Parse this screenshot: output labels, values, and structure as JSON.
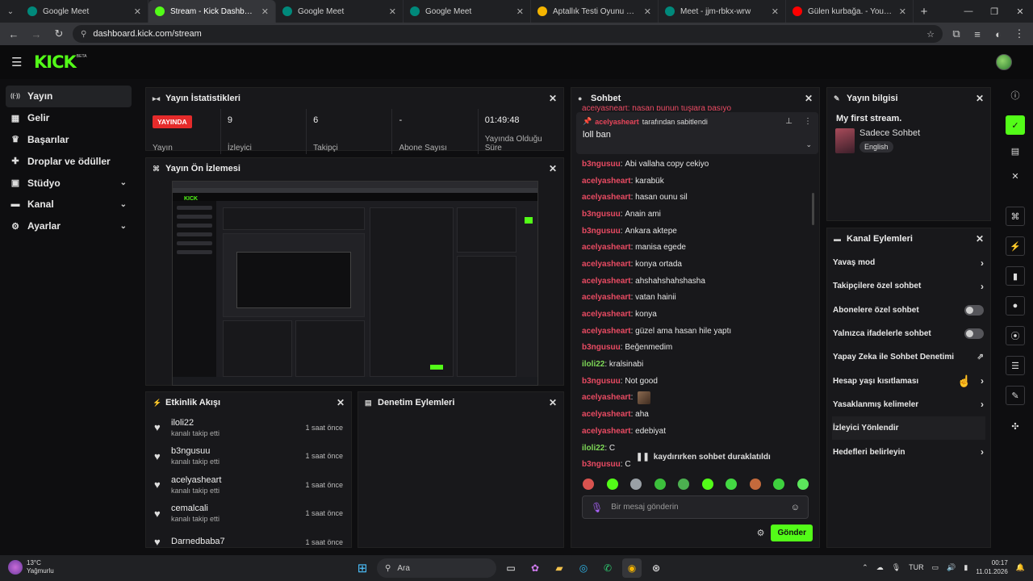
{
  "browser": {
    "tabs": [
      {
        "title": "Google Meet",
        "favicon_color": "#00897b",
        "active": false
      },
      {
        "title": "Stream - Kick Dashboard",
        "favicon_color": "#53fc18",
        "active": true
      },
      {
        "title": "Google Meet",
        "favicon_color": "#00897b",
        "active": false
      },
      {
        "title": "Google Meet",
        "favicon_color": "#00897b",
        "active": false
      },
      {
        "title": "Aptallık Testi Oyunu Oyna",
        "favicon_color": "#f4b400",
        "active": false
      },
      {
        "title": "Meet - jjm-rbkx-wrw",
        "favicon_color": "#00897b",
        "active": false
      },
      {
        "title": "Gülen kurbağa. - YouTube",
        "favicon_color": "#ff0000",
        "active": false
      }
    ],
    "url": "dashboard.kick.com/stream"
  },
  "brand": {
    "logo": "KICK",
    "beta": "BETA",
    "accent": "#53fc18"
  },
  "sidebar": {
    "items": [
      {
        "label": "Yayın",
        "icon": "broadcast-icon",
        "glyph": "((·))",
        "active": true,
        "chevron": false
      },
      {
        "label": "Gelir",
        "icon": "revenue-icon",
        "glyph": "▦",
        "active": false,
        "chevron": false
      },
      {
        "label": "Başarılar",
        "icon": "trophy-icon",
        "glyph": "♛",
        "active": false,
        "chevron": false
      },
      {
        "label": "Droplar ve ödüller",
        "icon": "gift-icon",
        "glyph": "✚",
        "active": false,
        "chevron": false
      },
      {
        "label": "Stüdyo",
        "icon": "studio-icon",
        "glyph": "▣",
        "active": false,
        "chevron": true
      },
      {
        "label": "Kanal",
        "icon": "channel-icon",
        "glyph": "▬",
        "active": false,
        "chevron": true
      },
      {
        "label": "Ayarlar",
        "icon": "settings-icon",
        "glyph": "⚙",
        "active": false,
        "chevron": true
      }
    ]
  },
  "stats_panel": {
    "title": "Yayın İstatistikleri",
    "live_badge": "YAYINDA",
    "stats": [
      {
        "value": "",
        "label": "Yayın"
      },
      {
        "value": "9",
        "label": "İzleyici"
      },
      {
        "value": "6",
        "label": "Takipçi"
      },
      {
        "value": "-",
        "label": "Abone Sayısı"
      },
      {
        "value": "01:49:48",
        "label": "Yayında Olduğu Süre"
      }
    ]
  },
  "preview_panel": {
    "title": "Yayın Ön İzlemesi"
  },
  "activity_panel": {
    "title": "Etkinlik Akışı",
    "items": [
      {
        "name": "iloli22",
        "desc": "kanalı takip etti",
        "time": "1 saat önce"
      },
      {
        "name": "b3ngusuu",
        "desc": "kanalı takip etti",
        "time": "1 saat önce"
      },
      {
        "name": "acelyasheart",
        "desc": "kanalı takip etti",
        "time": "1 saat önce"
      },
      {
        "name": "cemalcali",
        "desc": "kanalı takip etti",
        "time": "1 saat önce"
      },
      {
        "name": "Darnedbaba7",
        "desc": "",
        "time": "1 saat önce"
      }
    ]
  },
  "moderation_panel": {
    "title": "Denetim Eylemleri"
  },
  "chat_panel": {
    "title": "Sohbet",
    "top_cut": "acelyasheart: hasan bunun tuşlara basıyo",
    "pinned_by_user": "acelyasheart",
    "pinned_by_suffix": "tarafından sabitlendi",
    "pinned_message": "loll ban",
    "messages": [
      {
        "user": "b3ngusuu",
        "color": "pink",
        "text": "Abi vallaha copy cekiyo"
      },
      {
        "user": "acelyasheart",
        "color": "pink",
        "text": "karabük"
      },
      {
        "user": "acelyasheart",
        "color": "pink",
        "text": "hasan ounu sil"
      },
      {
        "user": "b3ngusuu",
        "color": "pink",
        "text": "Anain ami"
      },
      {
        "user": "b3ngusuu",
        "color": "pink",
        "text": "Ankara aktepe"
      },
      {
        "user": "acelyasheart",
        "color": "pink",
        "text": "manisa egede"
      },
      {
        "user": "acelyasheart",
        "color": "pink",
        "text": "konya ortada"
      },
      {
        "user": "acelyasheart",
        "color": "pink",
        "text": "ahshahshahshasha"
      },
      {
        "user": "acelyasheart",
        "color": "pink",
        "text": "vatan hainii"
      },
      {
        "user": "acelyasheart",
        "color": "pink",
        "text": "konya"
      },
      {
        "user": "acelyasheart",
        "color": "pink",
        "text": "güzel ama hasan hile yaptı"
      },
      {
        "user": "b3ngusuu",
        "color": "pink",
        "text": "Beğenmedim"
      },
      {
        "user": "iloli22",
        "color": "green",
        "text": "kralsinabi"
      },
      {
        "user": "b3ngusuu",
        "color": "pink",
        "text": "Not good"
      },
      {
        "user": "acelyasheart",
        "color": "pink",
        "text": "",
        "emote": true
      },
      {
        "user": "acelyasheart",
        "color": "pink",
        "text": "aha"
      },
      {
        "user": "acelyasheart",
        "color": "pink",
        "text": "edebiyat"
      },
      {
        "user": "iloli22",
        "color": "green",
        "text": "C"
      },
      {
        "user": "b3ngusuu",
        "color": "pink",
        "text": "C"
      }
    ],
    "paused_note": "kaydırırken sohbet duraklatıldı",
    "input_placeholder": "Bir mesaj gönderin",
    "send_label": "Gönder"
  },
  "info_panel": {
    "title": "Yayın bilgisi",
    "stream_title": "My first stream.",
    "category": "Sadece Sohbet",
    "language": "English"
  },
  "actions_panel": {
    "title": "Kanal Eylemleri",
    "items": [
      {
        "label": "Yavaş mod",
        "kind": "chevron"
      },
      {
        "label": "Takipçilere özel sohbet",
        "kind": "chevron"
      },
      {
        "label": "Abonelere özel sohbet",
        "kind": "toggle"
      },
      {
        "label": "Yalnızca ifadelerle sohbet",
        "kind": "toggle"
      },
      {
        "label": "Yapay Zeka ile Sohbet Denetimi",
        "kind": "external"
      },
      {
        "label": "Hesap yaşı kısıtlaması",
        "kind": "chevron"
      },
      {
        "label": "Yasaklanmış kelimeler",
        "kind": "chevron"
      },
      {
        "label": "İzleyici Yönlendir",
        "kind": "none"
      },
      {
        "label": "Hedefleri belirleyin",
        "kind": "chevron"
      }
    ]
  },
  "taskbar": {
    "temperature": "13°C",
    "weather": "Yağmurlu",
    "search": "Ara",
    "lang": "TUR",
    "time": "00:17",
    "date": "11.01.2026"
  }
}
